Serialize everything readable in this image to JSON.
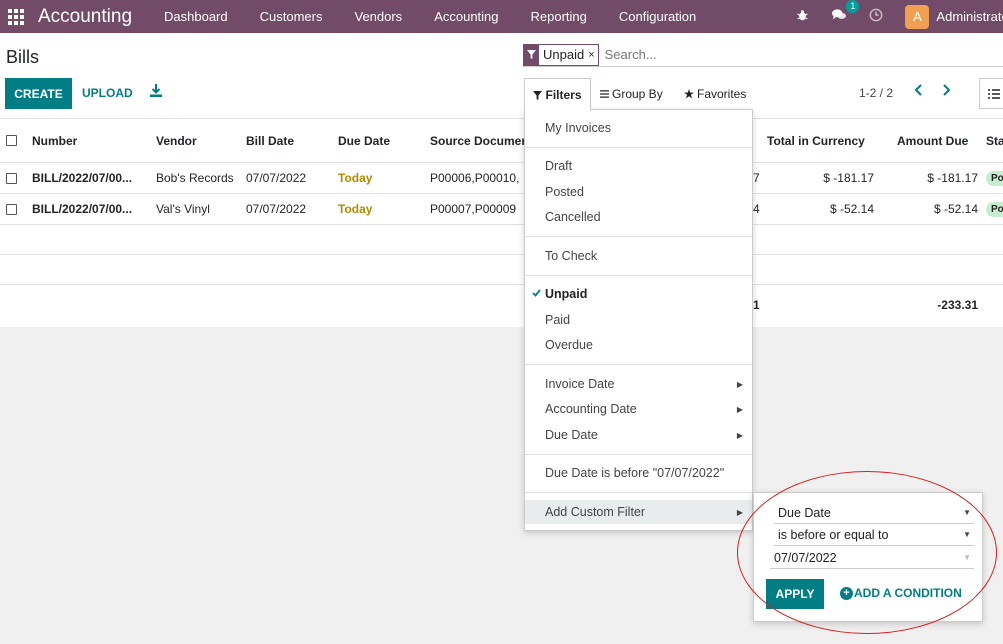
{
  "navbar": {
    "brand": "Accounting",
    "menu": [
      "Dashboard",
      "Customers",
      "Vendors",
      "Accounting",
      "Reporting",
      "Configuration"
    ],
    "messages_badge": "1",
    "avatar_letter": "A",
    "user": "Administrator"
  },
  "control": {
    "title": "Bills",
    "create_label": "CREATE",
    "upload_label": "UPLOAD",
    "facet": "Unpaid",
    "facet_remove": "×",
    "search_placeholder": "Search...",
    "filters_label": "Filters",
    "groupby_label": "Group By",
    "favorites_label": "Favorites",
    "pager": "1-2 / 2"
  },
  "table": {
    "headers": {
      "number": "Number",
      "vendor": "Vendor",
      "bill_date": "Bill Date",
      "due_date": "Due Date",
      "source": "Source Documen",
      "total_currency": "Total in Currency",
      "amount_due": "Amount Due",
      "status": "Sta"
    },
    "rows": [
      {
        "number": "BILL/2022/07/00...",
        "vendor": "Bob's Records",
        "bill_date": "07/07/2022",
        "due_date": "Today",
        "source": "P00006,P00010,",
        "partial": "7",
        "total_currency": "$ -181.17",
        "amount_due": "$ -181.17",
        "status": "Po"
      },
      {
        "number": "BILL/2022/07/00...",
        "vendor": "Val's Vinyl",
        "bill_date": "07/07/2022",
        "due_date": "Today",
        "source": "P00007,P00009",
        "partial": "4",
        "total_currency": "$ -52.14",
        "amount_due": "$ -52.14",
        "status": "Po"
      }
    ],
    "total_partial": "1",
    "total_amount_due": "-233.31"
  },
  "filters_dropdown": {
    "items": [
      {
        "label": "My Invoices"
      },
      {
        "label": "Draft"
      },
      {
        "label": "Posted"
      },
      {
        "label": "Cancelled"
      },
      {
        "label": "To Check"
      },
      {
        "label": "Unpaid",
        "checked": true
      },
      {
        "label": "Paid"
      },
      {
        "label": "Overdue"
      },
      {
        "label": "Invoice Date"
      },
      {
        "label": "Accounting Date"
      },
      {
        "label": "Due Date"
      },
      {
        "label": "Due Date is before \"07/07/2022\""
      },
      {
        "label": "Add Custom Filter"
      }
    ]
  },
  "custom_filter": {
    "field": "Due Date",
    "operator": "is before or equal to",
    "value": "07/07/2022",
    "apply_label": "APPLY",
    "add_condition_label": "ADD A CONDITION"
  },
  "colors": {
    "navbar": "#714b67",
    "primary": "#017e84",
    "today": "#b48b00",
    "annotation": "#d51f1f"
  }
}
